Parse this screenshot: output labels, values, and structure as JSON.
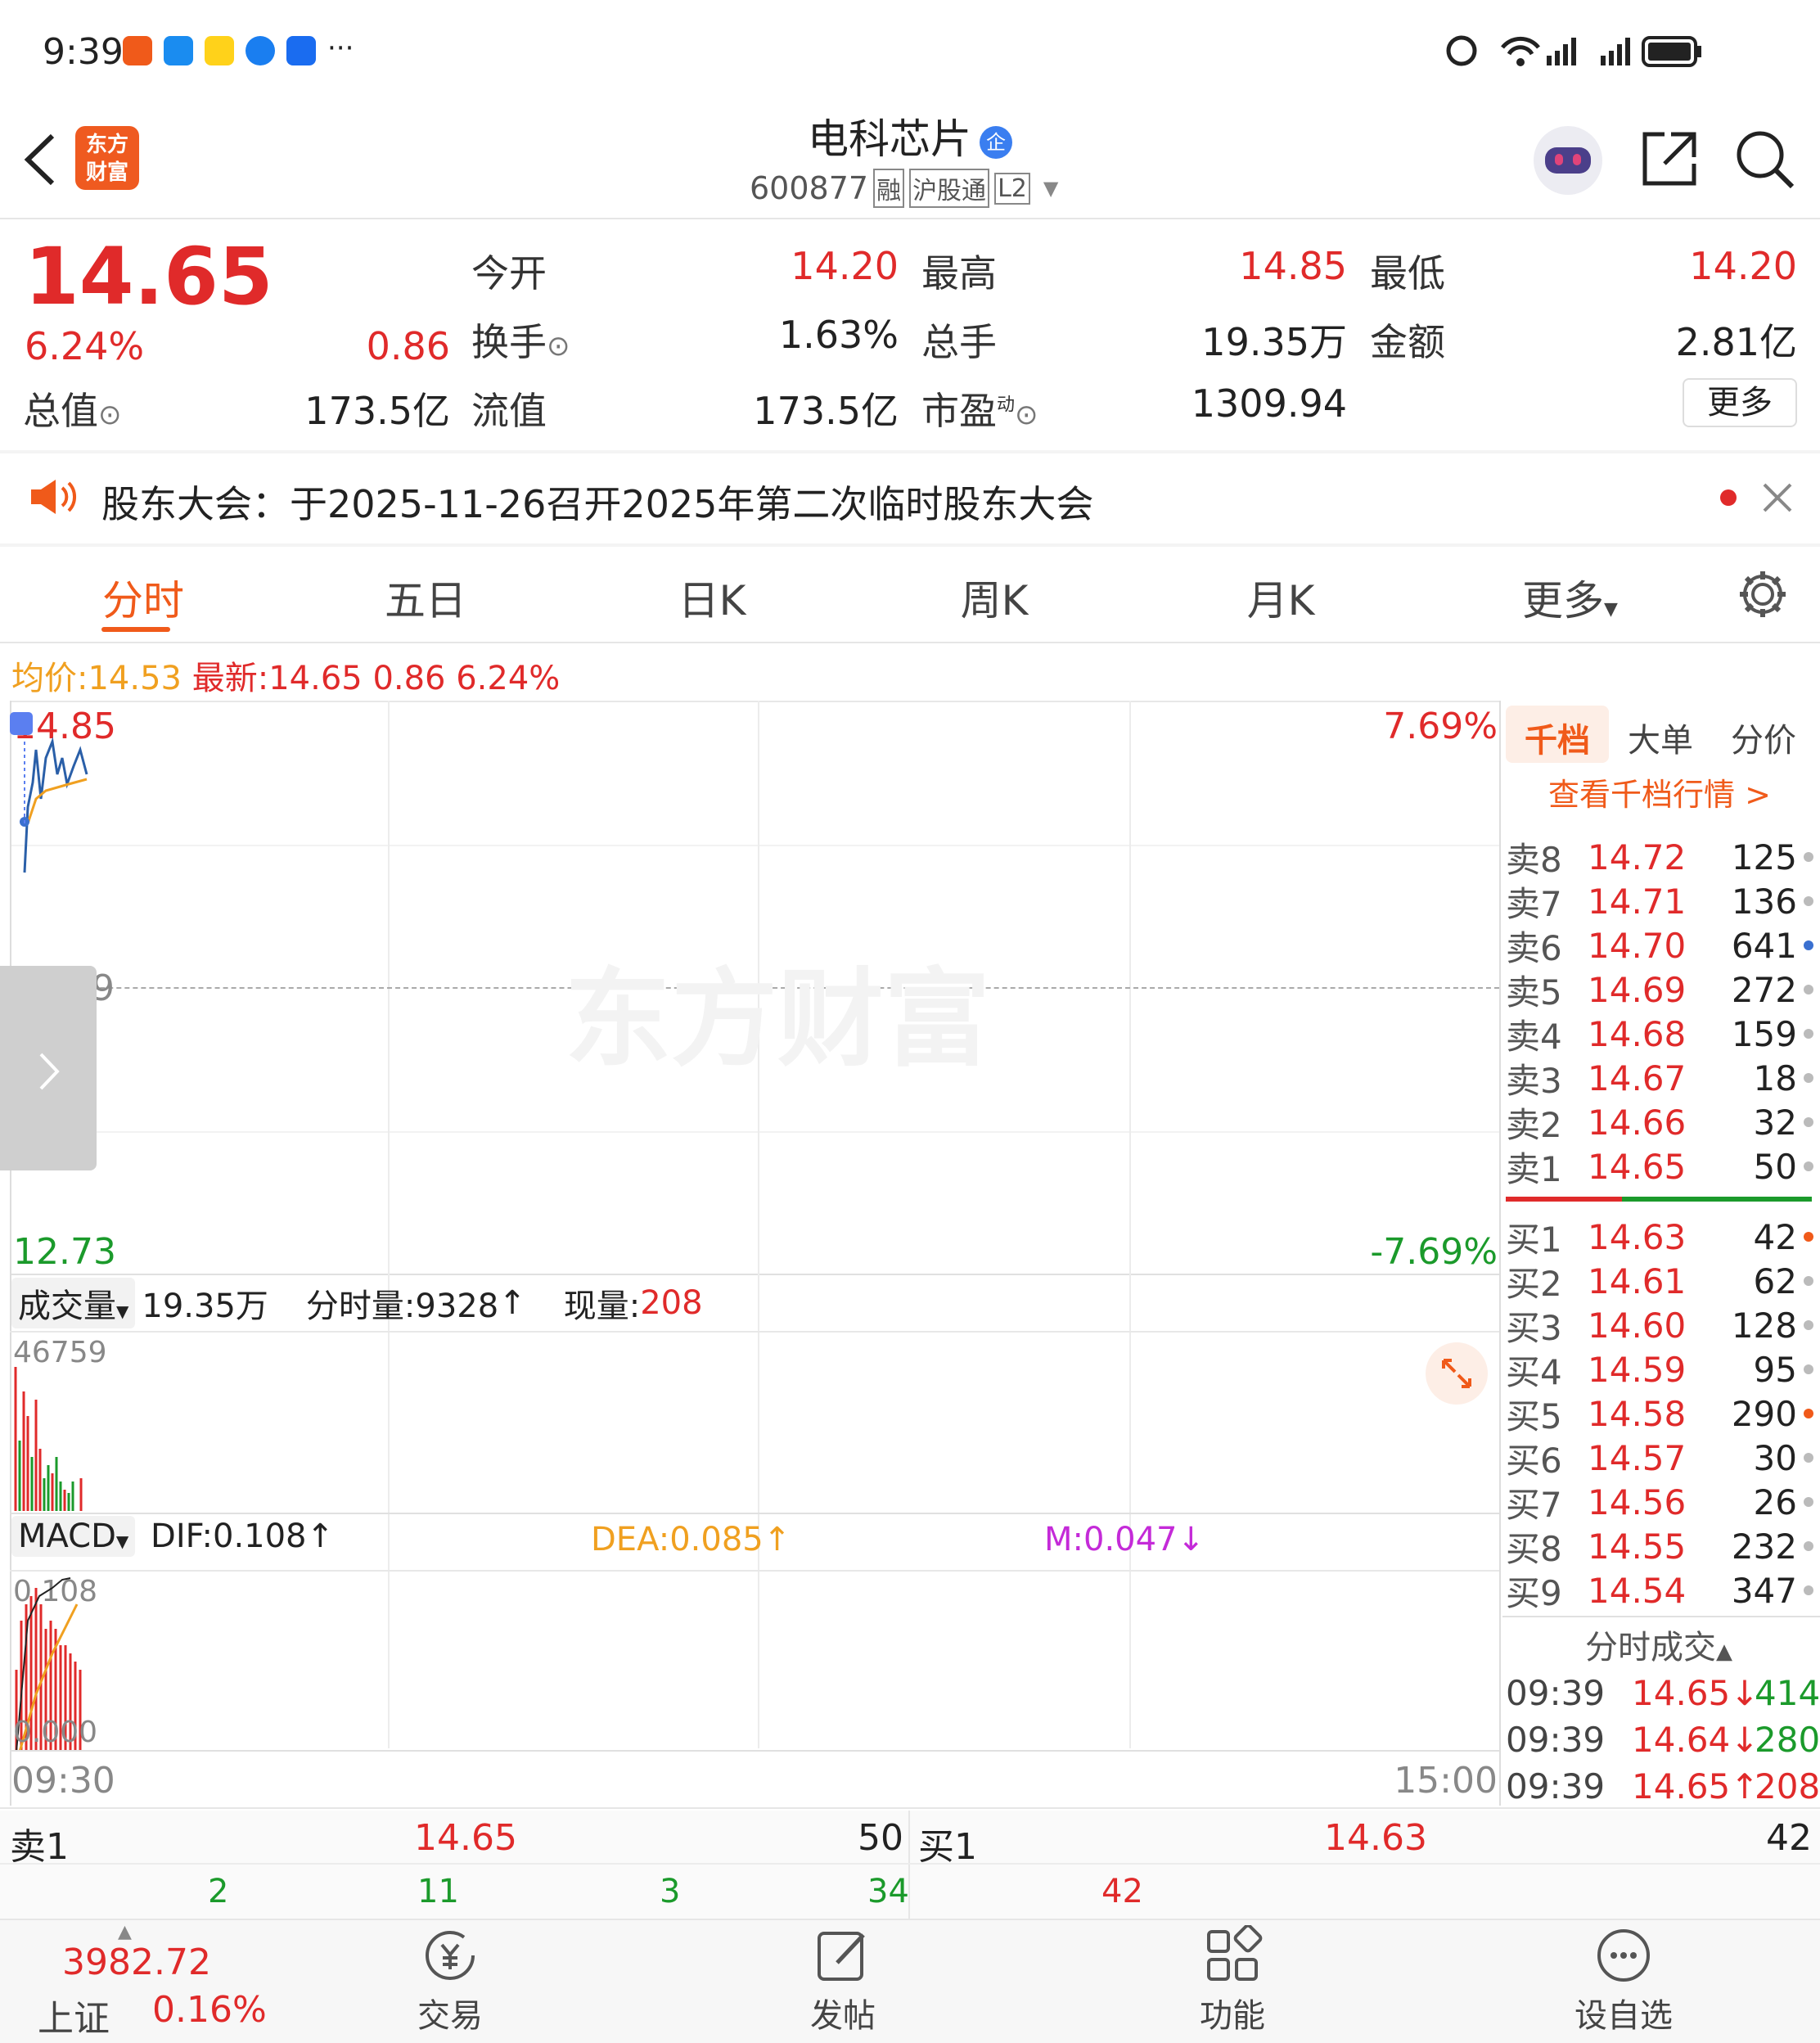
{
  "status_bar": {
    "time": "9:39"
  },
  "header": {
    "title": "电科芯片",
    "code": "600877",
    "tags": [
      "融",
      "沪股通",
      "L2"
    ],
    "logo_text": "东方财富"
  },
  "quote": {
    "price": "14.65",
    "change_pct": "6.24%",
    "change": "0.86",
    "open_label": "今开",
    "open": "14.20",
    "high_label": "最高",
    "high": "14.85",
    "low_label": "最低",
    "low": "14.20",
    "turnover_label": "换手",
    "turnover": "1.63%",
    "volume_label": "总手",
    "volume": "19.35万",
    "amount_label": "金额",
    "amount": "2.81亿",
    "mktcap_label": "总值",
    "mktcap": "173.5亿",
    "float_label": "流值",
    "float_cap": "173.5亿",
    "pe_label": "市盈",
    "pe_sup": "动",
    "pe": "1309.94",
    "more_label": "更多"
  },
  "notice": {
    "text": "股东大会：于2025-11-26召开2025年第二次临时股东大会"
  },
  "tabs": [
    "分时",
    "五日",
    "日K",
    "周K",
    "月K",
    "更多"
  ],
  "info_line": {
    "avg_label": "均价:",
    "avg": "14.53",
    "latest_label": "最新:",
    "latest": "14.65",
    "chg": "0.86",
    "pct": "6.24%"
  },
  "chart": {
    "y_top": "14.85",
    "y_mid": "13.79",
    "y_bot": "12.73",
    "pct_top": "7.69%",
    "pct_bot": "-7.69%",
    "x_start": "09:30",
    "x_end": "15:00",
    "watermark": "东方财富"
  },
  "volume_panel": {
    "label": "成交量",
    "total": "19.35万",
    "min_vol": "分时量:9328",
    "min_arrow": "↑",
    "cur_label": "现量:",
    "cur": "208",
    "max": "46759"
  },
  "macd_panel": {
    "label": "MACD",
    "dif": "DIF:0.108",
    "dif_arrow": "↑",
    "dea": "DEA:0.085",
    "dea_arrow": "↑",
    "m": "M:0.047",
    "m_arrow": "↓",
    "top": "0.108",
    "bot": "0.000"
  },
  "depth": {
    "tabs": [
      "千档",
      "大单",
      "分价"
    ],
    "link": "查看千档行情 >",
    "asks": [
      {
        "l": "卖8",
        "p": "14.72",
        "v": "125"
      },
      {
        "l": "卖7",
        "p": "14.71",
        "v": "136"
      },
      {
        "l": "卖6",
        "p": "14.70",
        "v": "641"
      },
      {
        "l": "卖5",
        "p": "14.69",
        "v": "272"
      },
      {
        "l": "卖4",
        "p": "14.68",
        "v": "159"
      },
      {
        "l": "卖3",
        "p": "14.67",
        "v": "18"
      },
      {
        "l": "卖2",
        "p": "14.66",
        "v": "32"
      },
      {
        "l": "卖1",
        "p": "14.65",
        "v": "50"
      }
    ],
    "bids": [
      {
        "l": "买1",
        "p": "14.63",
        "v": "42"
      },
      {
        "l": "买2",
        "p": "14.61",
        "v": "62"
      },
      {
        "l": "买3",
        "p": "14.60",
        "v": "128"
      },
      {
        "l": "买4",
        "p": "14.59",
        "v": "95"
      },
      {
        "l": "买5",
        "p": "14.58",
        "v": "290"
      },
      {
        "l": "买6",
        "p": "14.57",
        "v": "30"
      },
      {
        "l": "买7",
        "p": "14.56",
        "v": "26"
      },
      {
        "l": "买8",
        "p": "14.55",
        "v": "232"
      },
      {
        "l": "买9",
        "p": "14.54",
        "v": "347"
      }
    ],
    "trades_label": "分时成交",
    "trades": [
      {
        "t": "09:39",
        "p": "14.65↓",
        "v": "414"
      },
      {
        "t": "09:39",
        "p": "14.64↓",
        "v": "280"
      },
      {
        "t": "09:39",
        "p": "14.65↑",
        "v": "208"
      }
    ]
  },
  "bottom_book": {
    "ask_label": "卖1",
    "ask_price": "14.65",
    "ask_vol": "50",
    "bid_label": "买1",
    "bid_price": "14.63",
    "bid_vol": "42",
    "q1": "2",
    "q2": "11",
    "q3": "3",
    "q4": "34",
    "q5": "42"
  },
  "nav": {
    "index_value": "3982.72",
    "index_name": "上证",
    "index_pct": "0.16%",
    "items": [
      "交易",
      "发帖",
      "功能",
      "设自选"
    ]
  }
}
